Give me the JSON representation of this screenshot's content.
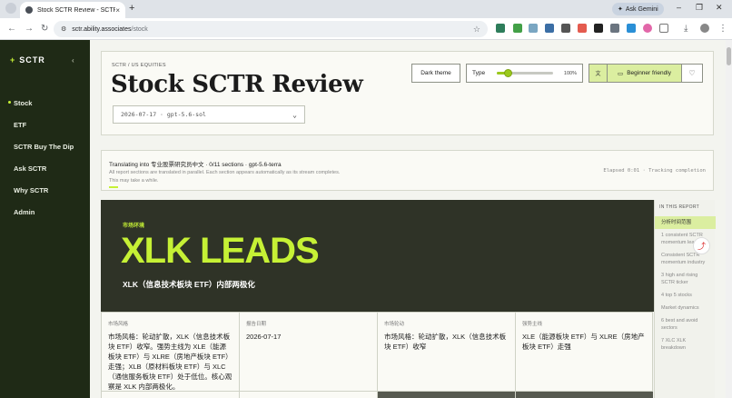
{
  "browser": {
    "tab_title": "Stock SCTR Review - SCTR",
    "tab_close": "×",
    "new_tab": "+",
    "url_host": "sctr.ability.associates",
    "url_path": "/stock",
    "ask_gemini": "Ask Gemini",
    "window_min": "–",
    "window_max": "❐",
    "window_close": "✕"
  },
  "sidebar": {
    "brand": "SCTR",
    "items": [
      {
        "label": "Stock",
        "active": true
      },
      {
        "label": "ETF"
      },
      {
        "label": "SCTR Buy The Dip"
      },
      {
        "label": "Ask SCTR"
      },
      {
        "label": "Why SCTR"
      },
      {
        "label": "Admin"
      }
    ]
  },
  "header": {
    "eyebrow": "SCTR / US EQUITIES",
    "title": "Stock SCTR Review",
    "report_select": "2026-07-17 · gpt-5.6-sol",
    "dark_theme": "Dark theme",
    "type_label": "Type",
    "type_value_pct": "100%",
    "type_level": 0.2,
    "mode_icon": "文",
    "beginner": "Beginner friendly"
  },
  "translation": {
    "title": "Translating into 专业股票研究员中文 · 0/11 sections · gpt-5.6-terra",
    "desc": "All report sections are translated in parallel. Each section appears automatically as its stream completes. This may take a while.",
    "elapsed": "Elapsed 0:01 · Tracking completion"
  },
  "hero": {
    "eyebrow": "市场环境",
    "title": "XLK LEADS",
    "subtitle": "XLK（信息技术板块 ETF）内部两极化"
  },
  "cells": [
    {
      "label": "市场风格",
      "value": "市场风格：轮动扩散，XLK（信息技术板块 ETF）收窄。强势主线为 XLE（能源板块 ETF）与 XLRE（房地产板块 ETF）走强；XLB（原材料板块 ETF）与 XLC（通信服务板块 ETF）处于低位。核心观察是 XLK 内部两极化。"
    },
    {
      "label": "报告日期",
      "value": "2026-07-17"
    },
    {
      "label": "市场轮动",
      "value": "市场风格：轮动扩散，XLK（信息技术板块 ETF）收窄"
    },
    {
      "label": "强势主线",
      "value": "XLE（能源板块 ETF）与 XLRE（房地产板块 ETF）走强"
    }
  ],
  "toc": {
    "heading": "IN THIS REPORT",
    "items": [
      "分析时间范围",
      "1 consistent SCTR momentum leaders",
      "Consistent SCTR momentum industry",
      "3 high and rising SCTR ticker",
      "4 top 5 stocks",
      "Market dynamics",
      "6 best and avoid sectors",
      "7 XLC XLK breakdown"
    ]
  }
}
